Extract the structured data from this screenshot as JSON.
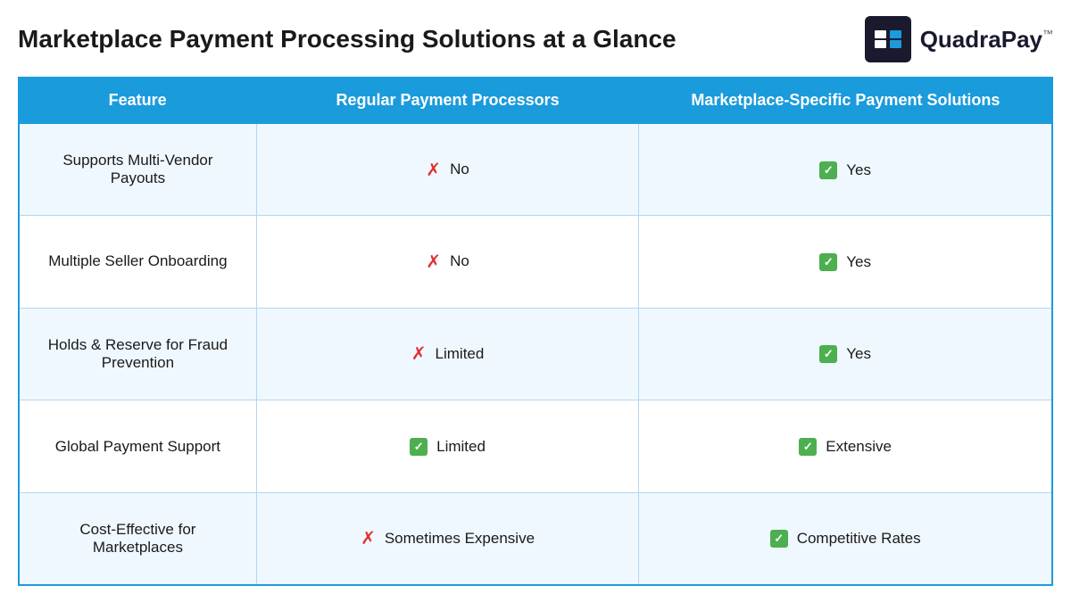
{
  "header": {
    "title": "Marketplace Payment Processing Solutions at a Glance",
    "logo_text": "QuadraPay",
    "logo_tm": "™"
  },
  "table": {
    "columns": [
      {
        "id": "feature",
        "label": "Feature"
      },
      {
        "id": "regular",
        "label": "Regular Payment Processors"
      },
      {
        "id": "marketplace",
        "label": "Marketplace-Specific Payment Solutions"
      }
    ],
    "rows": [
      {
        "feature": "Supports Multi-Vendor Payouts",
        "regular_icon": "x",
        "regular_value": "No",
        "marketplace_icon": "check",
        "marketplace_value": "Yes"
      },
      {
        "feature": "Multiple Seller Onboarding",
        "regular_icon": "x",
        "regular_value": "No",
        "marketplace_icon": "check",
        "marketplace_value": "Yes"
      },
      {
        "feature": "Holds & Reserve for Fraud Prevention",
        "regular_icon": "x",
        "regular_value": "Limited",
        "marketplace_icon": "check",
        "marketplace_value": "Yes"
      },
      {
        "feature": "Global Payment Support",
        "regular_icon": "check",
        "regular_value": "Limited",
        "marketplace_icon": "check",
        "marketplace_value": "Extensive"
      },
      {
        "feature": "Cost-Effective for Marketplaces",
        "regular_icon": "x",
        "regular_value": "Sometimes Expensive",
        "marketplace_icon": "check",
        "marketplace_value": "Competitive Rates"
      }
    ]
  }
}
